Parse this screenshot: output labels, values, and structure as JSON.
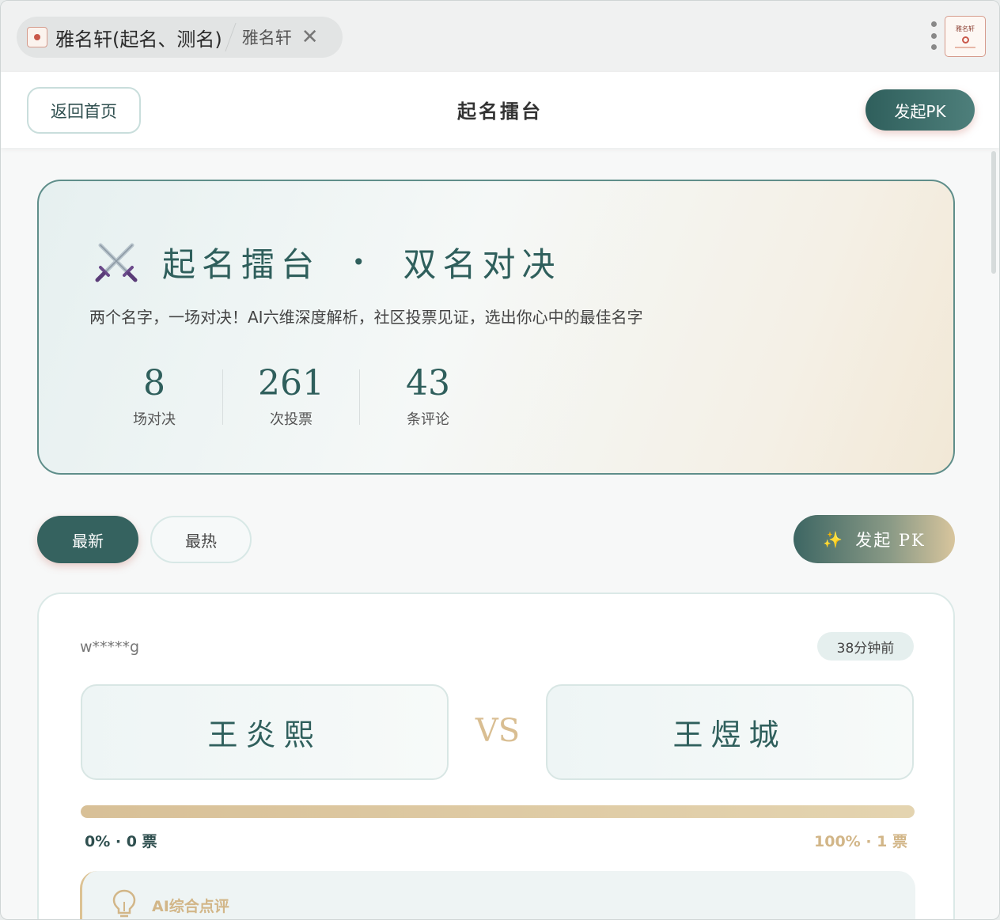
{
  "tab": {
    "title": "雅名轩(起名、测名)",
    "subtitle": "雅名轩"
  },
  "header": {
    "back_label": "返回首页",
    "title": "起名擂台",
    "pk_label": "发起PK"
  },
  "hero": {
    "title_left": "起名擂台",
    "title_sep": "•",
    "title_right": "双名对决",
    "subtitle": "两个名字，一场对决！AI六维深度解析，社区投票见证，选出你心中的最佳名字",
    "stats": [
      {
        "value": "8",
        "label": "场对决"
      },
      {
        "value": "261",
        "label": "次投票"
      },
      {
        "value": "43",
        "label": "条评论"
      }
    ]
  },
  "filters": {
    "newest": "最新",
    "hottest": "最热",
    "pk_label": "发起 PK"
  },
  "battle": {
    "user": "w*****g",
    "time": "38分钟前",
    "name_a": "王炎熙",
    "vs": "VS",
    "name_b": "王煜城",
    "share_b": 1.0,
    "left_result": "0% · 0 票",
    "right_result": "100% · 1 票",
    "ai_title": "AI综合点评"
  },
  "colors": {
    "primary": "#2f5f5c",
    "gold": "#d2b688",
    "accent_red": "#c9584a"
  }
}
